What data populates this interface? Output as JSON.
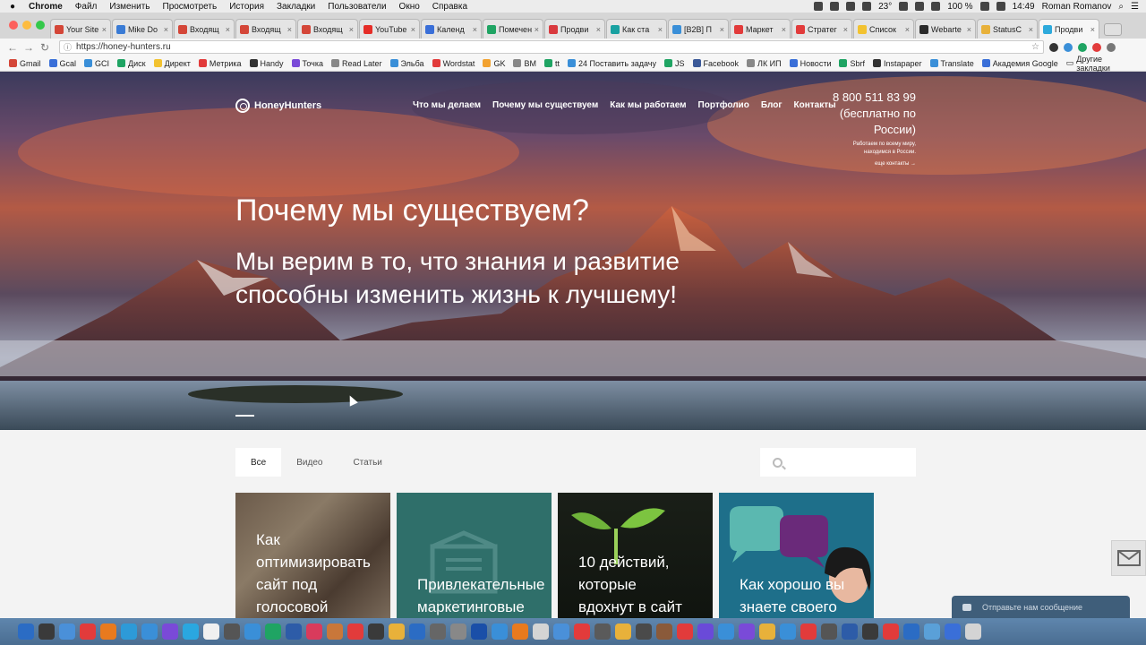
{
  "menubar": {
    "items": [
      "Chrome",
      "Файл",
      "Изменить",
      "Просмотреть",
      "История",
      "Закладки",
      "Пользователи",
      "Окно",
      "Справка"
    ],
    "temperature": "23°",
    "battery": "100 %",
    "time": "14:49",
    "user": "Roman Romanov"
  },
  "tabs": [
    {
      "title": "Your Site",
      "color": "#d44638"
    },
    {
      "title": "Mike Do",
      "color": "#3a7bd5"
    },
    {
      "title": "Входящ",
      "color": "#d44638"
    },
    {
      "title": "Входящ",
      "color": "#d44638"
    },
    {
      "title": "Входящ",
      "color": "#d44638"
    },
    {
      "title": "YouTube",
      "color": "#e52d27"
    },
    {
      "title": "Календ",
      "color": "#3a6fd8"
    },
    {
      "title": "Помечен",
      "color": "#1fa463"
    },
    {
      "title": "Продви",
      "color": "#d9393e"
    },
    {
      "title": "Как ста",
      "color": "#19a1a1"
    },
    {
      "title": "[B2B] П",
      "color": "#3a8fd8"
    },
    {
      "title": "Маркет",
      "color": "#e23b3b"
    },
    {
      "title": "Стратег",
      "color": "#e23b3b"
    },
    {
      "title": "Список",
      "color": "#f2c230"
    },
    {
      "title": "Webarte",
      "color": "#2a2a2a"
    },
    {
      "title": "StatusC",
      "color": "#e8b13a"
    },
    {
      "title": "Продви",
      "color": "#2eaadc",
      "active": true
    }
  ],
  "address": {
    "url": "https://honey-hunters.ru"
  },
  "bookmarks": [
    {
      "label": "Gmail",
      "color": "#d44638"
    },
    {
      "label": "Gcal",
      "color": "#3a6fd8"
    },
    {
      "label": "GCI",
      "color": "#3a8fd8"
    },
    {
      "label": "Диск",
      "color": "#1fa463"
    },
    {
      "label": "Директ",
      "color": "#f2c230"
    },
    {
      "label": "Метрика",
      "color": "#e23b3b"
    },
    {
      "label": "Handy",
      "color": "#333333"
    },
    {
      "label": "Точка",
      "color": "#7a4ad8"
    },
    {
      "label": "Read Later",
      "color": "#888888"
    },
    {
      "label": "Эльба",
      "color": "#3a8fd8"
    },
    {
      "label": "Wordstat",
      "color": "#e23b3b"
    },
    {
      "label": "GK",
      "color": "#f2a230"
    },
    {
      "label": "BM",
      "color": "#888888"
    },
    {
      "label": "tt",
      "color": "#1fa463"
    },
    {
      "label": "24 Поставить задачу",
      "color": "#3a8fd8"
    },
    {
      "label": "JS",
      "color": "#1fa463"
    },
    {
      "label": "Facebook",
      "color": "#3b5998"
    },
    {
      "label": "ЛК ИП",
      "color": "#888888"
    },
    {
      "label": "Новости",
      "color": "#3a6fd8"
    },
    {
      "label": "Sbrf",
      "color": "#1fa463"
    },
    {
      "label": "Instapaper",
      "color": "#333333"
    },
    {
      "label": "Translate",
      "color": "#3a8fd8"
    },
    {
      "label": "Академия Google",
      "color": "#3a6fd8"
    }
  ],
  "bookmarks_other": "Другие закладки",
  "site": {
    "logo": "HoneyHunters",
    "nav": [
      "Что мы делаем",
      "Почему мы существуем",
      "Как мы работаем",
      "Портфолио",
      "Блог",
      "Контакты"
    ],
    "phone": "8 800 511 83 99",
    "phone_note": "(бесплатно по России)",
    "work_note_1": "Работаем по всему миру,",
    "work_note_2": "находимся в России.",
    "more_contacts": "еще контакты →",
    "hero_title": "Почему мы существуем?",
    "hero_subtitle": "Мы верим в то, что знания и развитие способны изменить жизнь к лучшему!"
  },
  "filters": {
    "tabs": [
      {
        "label": "Все",
        "active": true
      },
      {
        "label": "Видео"
      },
      {
        "label": "Статьи"
      }
    ],
    "search_placeholder": ""
  },
  "cards": [
    {
      "title_lines": [
        "Как",
        "оптимизировать",
        "сайт под",
        "голосовой"
      ]
    },
    {
      "title_lines": [
        "Привлекательные",
        "маркетинговые"
      ]
    },
    {
      "title_lines": [
        "10 действий,",
        "которые",
        "вдохнут в сайт"
      ]
    },
    {
      "title_lines": [
        "Как хорошо вы",
        "знаете своего"
      ]
    }
  ],
  "chat": {
    "label": "Отправьте нам сообщение"
  },
  "dock_colors": [
    "#2b6cc4",
    "#3a3a3a",
    "#4a90d9",
    "#e23b3b",
    "#e87a1e",
    "#2d9ad8",
    "#3a8fd8",
    "#7a4ad8",
    "#2aa7e0",
    "#f0f0f0",
    "#555555",
    "#3a8fd8",
    "#1fa463",
    "#2d5ca8",
    "#d93b5c",
    "#c9773a",
    "#e23b3b",
    "#3a3a3a",
    "#e8b13a",
    "#2b6cc4",
    "#666666",
    "#888888",
    "#1a4fa8",
    "#3a8fd8",
    "#e87a1e",
    "#d4d4d4",
    "#4a90d9",
    "#e23b3b",
    "#5a5a5a",
    "#e8b13a",
    "#4a4a4a",
    "#8a5a3a",
    "#e23b3b",
    "#6a4ad8",
    "#3a8fd8",
    "#7a4ad8",
    "#e8b13a",
    "#3a8fd8",
    "#e23b3b",
    "#555555",
    "#2d5ca8",
    "#3a3a3a",
    "#e23b3b",
    "#2b6cc4",
    "#5aa0d8",
    "#3a6fd8",
    "#d4d4d4"
  ]
}
